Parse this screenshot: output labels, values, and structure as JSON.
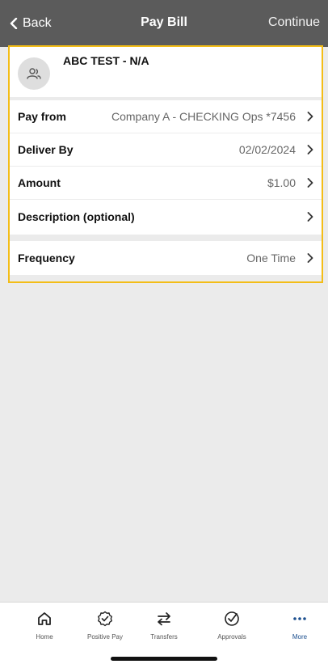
{
  "header": {
    "back_label": "Back",
    "title": "Pay Bill",
    "continue_label": "Continue"
  },
  "payee": {
    "name": "ABC TEST - N/A",
    "avatar_icon": "people-icon"
  },
  "rows": [
    {
      "label": "Pay from",
      "value": "Company A - CHECKING Ops *7456"
    },
    {
      "label": "Deliver By",
      "value": "02/02/2024"
    },
    {
      "label": "Amount",
      "value": "$1.00"
    },
    {
      "label": "Description (optional)",
      "value": ""
    }
  ],
  "frequency": {
    "label": "Frequency",
    "value": "One Time"
  },
  "tabs": [
    {
      "label": "Home",
      "icon": "home-icon"
    },
    {
      "label": "Positive Pay",
      "icon": "badge-check-icon"
    },
    {
      "label": "Transfers",
      "icon": "transfer-arrows-icon"
    },
    {
      "label": "Approvals",
      "icon": "circle-check-icon"
    },
    {
      "label": "More",
      "icon": "more-dots-icon"
    }
  ],
  "colors": {
    "header_bg": "#5b5b5b",
    "highlight": "#f3bd17",
    "active_tab": "#1c4f8f"
  }
}
